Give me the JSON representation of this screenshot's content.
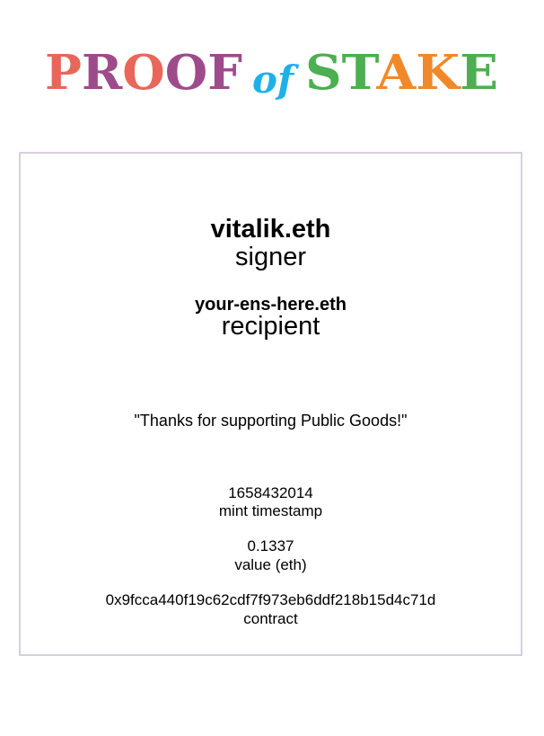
{
  "logo": {
    "proof": "PROOF",
    "of": "of",
    "stake": "STAKE",
    "colors": {
      "P": "#e8675a",
      "R": "#9e4b8c",
      "O1": "#e8675a",
      "O2": "#9e4b8c",
      "F": "#9e4b8c",
      "of": "#1fb1e6",
      "S": "#4caf50",
      "T": "#4caf50",
      "A": "#f0892a",
      "K": "#f0892a",
      "E": "#4caf50"
    }
  },
  "card": {
    "signer": {
      "name": "vitalik.eth",
      "role": "signer"
    },
    "recipient": {
      "name": "your-ens-here.eth",
      "role": "recipient"
    },
    "message": "\"Thanks for supporting Public Goods!\"",
    "details": [
      {
        "value": "1658432014",
        "label": "mint timestamp"
      },
      {
        "value": "0.1337",
        "label": "value (eth)"
      },
      {
        "value": "0x9fcca440f19c62cdf7f973eb6ddf218b15d4c71d",
        "label": "contract"
      }
    ]
  },
  "border_color": "#d8cfdb"
}
